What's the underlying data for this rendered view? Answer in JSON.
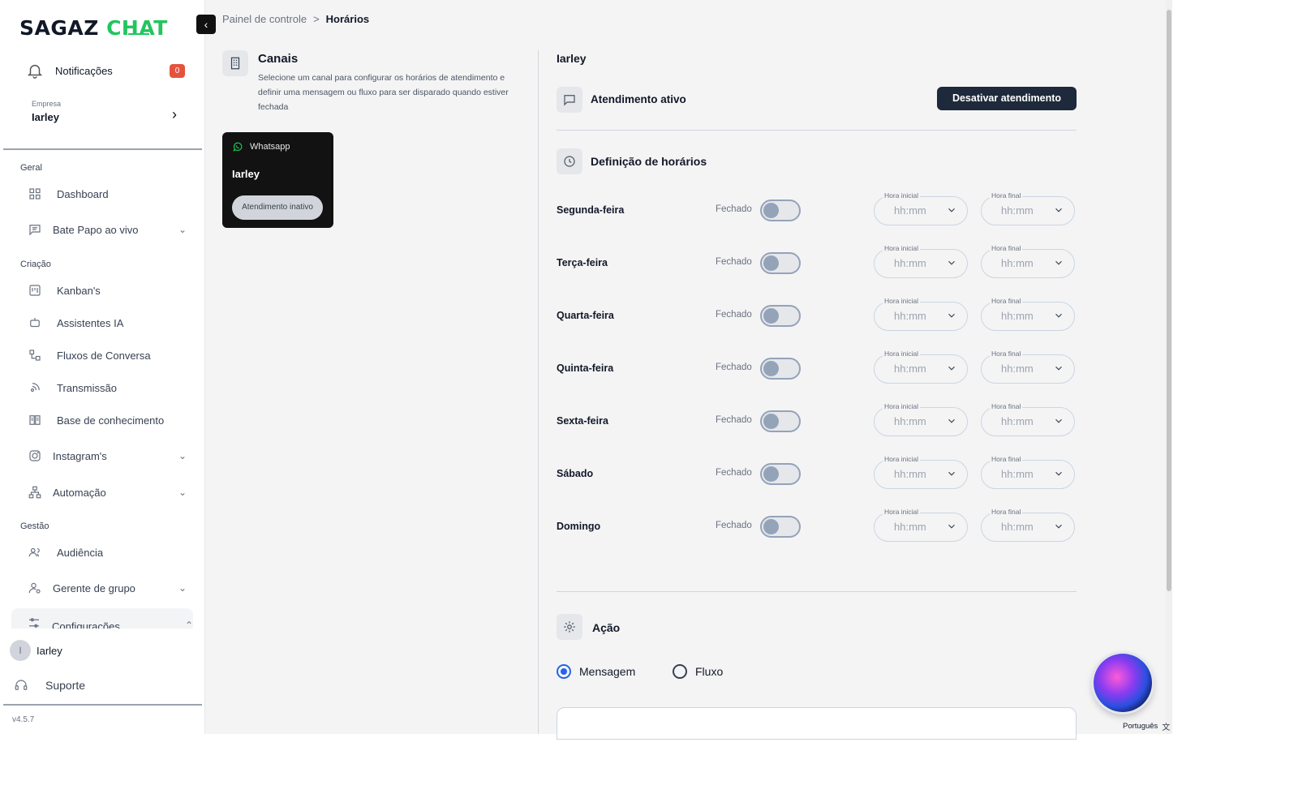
{
  "brand": {
    "part1": "SAGAZ",
    "part2": "CHAT",
    "accent": "#22c55e"
  },
  "sidebar": {
    "notifications": {
      "label": "Notificações",
      "count": "0"
    },
    "company": {
      "caption": "Empresa",
      "name": "Iarley"
    },
    "sections": {
      "geral": "Geral",
      "criacao": "Criação",
      "gestao": "Gestão"
    },
    "items": {
      "dashboard": "Dashboard",
      "bate_papo": "Bate Papo ao vivo",
      "kanban": "Kanban's",
      "assistentes": "Assistentes IA",
      "fluxos": "Fluxos de Conversa",
      "transmissao": "Transmissão",
      "base": "Base de conhecimento",
      "instagram": "Instagram's",
      "automacao": "Automação",
      "audiencia": "Audiência",
      "gerente": "Gerente de grupo",
      "configuracoes": "Configurações"
    },
    "user": {
      "initial": "I",
      "name": "Iarley"
    },
    "support": "Suporte",
    "version": "v4.5.7"
  },
  "breadcrumb": {
    "root": "Painel de controle",
    "sep": ">",
    "current": "Horários"
  },
  "canais": {
    "title": "Canais",
    "description": "Selecione um canal para configurar os horários de atendimento e definir uma mensagem ou fluxo para ser disparado quando estiver fechada",
    "card": {
      "type": "Whatsapp",
      "name": "Iarley",
      "status": "Atendimento inativo"
    }
  },
  "panel": {
    "title": "Iarley",
    "attendance": {
      "label": "Atendimento ativo",
      "button": "Desativar atendimento"
    },
    "schedule": {
      "heading": "Definição de horários",
      "closed_label": "Fechado",
      "start_label": "Hora inicial",
      "end_label": "Hora final",
      "placeholder": "hh:mm",
      "days": [
        "Segunda-feira",
        "Terça-feira",
        "Quarta-feira",
        "Quinta-feira",
        "Sexta-feira",
        "Sábado",
        "Domingo"
      ]
    },
    "action": {
      "heading": "Ação",
      "options": {
        "message": "Mensagem",
        "flow": "Fluxo"
      },
      "selected": "Mensagem"
    }
  },
  "language": "Português"
}
